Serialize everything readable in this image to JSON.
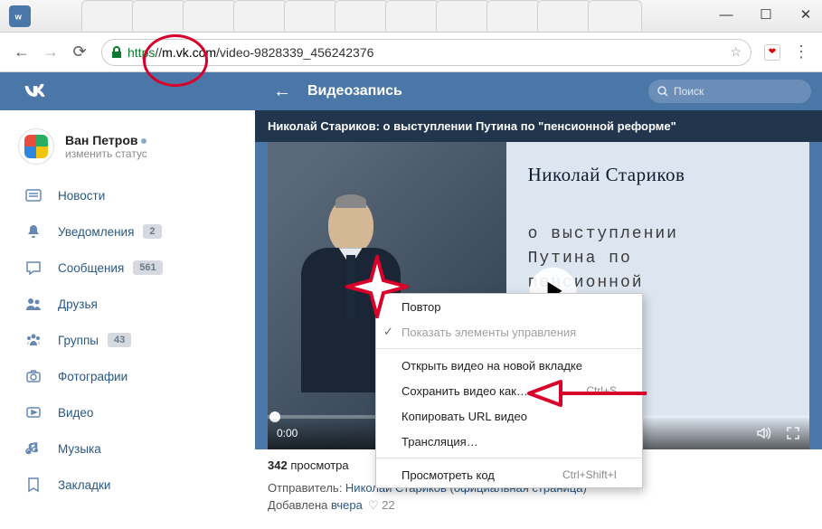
{
  "browser": {
    "url_https": "https",
    "url_prefix": "//",
    "url_highlighted": "m.vk.com",
    "url_rest": "/video-9828339_456242376"
  },
  "vk_header": {
    "title": "Видеозапись",
    "search_placeholder": "Поиск"
  },
  "profile": {
    "name": "Ван Петров",
    "status": "изменить статус"
  },
  "nav": [
    {
      "icon": "news",
      "label": "Новости",
      "badge": null
    },
    {
      "icon": "bell",
      "label": "Уведомления",
      "badge": "2"
    },
    {
      "icon": "msg",
      "label": "Сообщения",
      "badge": "561"
    },
    {
      "icon": "friends",
      "label": "Друзья",
      "badge": null
    },
    {
      "icon": "groups",
      "label": "Группы",
      "badge": "43"
    },
    {
      "icon": "photo",
      "label": "Фотографии",
      "badge": null
    },
    {
      "icon": "video",
      "label": "Видео",
      "badge": null
    },
    {
      "icon": "music",
      "label": "Музыка",
      "badge": null
    },
    {
      "icon": "bookmark",
      "label": "Закладки",
      "badge": null
    }
  ],
  "video": {
    "title": "Николай Стариков: о выступлении Путина по \"пенсионной реформе\"",
    "overlay_name": "Николай Стариков",
    "overlay_subtitle": "о выступлении\nПутина по\nпенсионной\nреформе\"",
    "time": "0:00",
    "views_num": "342",
    "views_label": " просмотра",
    "sender_label": "Отправитель: ",
    "sender_name": "Николай Стариков (официальная страница)",
    "added_label": "Добавлена ",
    "added_when": "вчера",
    "likes": "22"
  },
  "context_menu": {
    "items": [
      {
        "label": "Повтор",
        "type": "normal"
      },
      {
        "label": "Показать элементы управления",
        "type": "checked_disabled"
      },
      {
        "label": "",
        "type": "sep"
      },
      {
        "label": "Открыть видео на новой вкладке",
        "type": "normal"
      },
      {
        "label": "Сохранить видео как…",
        "type": "normal",
        "shortcut": "Ctrl+S"
      },
      {
        "label": "Копировать URL видео",
        "type": "normal"
      },
      {
        "label": "Трансляция…",
        "type": "normal"
      },
      {
        "label": "",
        "type": "sep"
      },
      {
        "label": "Просмотреть код",
        "type": "normal",
        "shortcut": "Ctrl+Shift+I"
      }
    ]
  }
}
